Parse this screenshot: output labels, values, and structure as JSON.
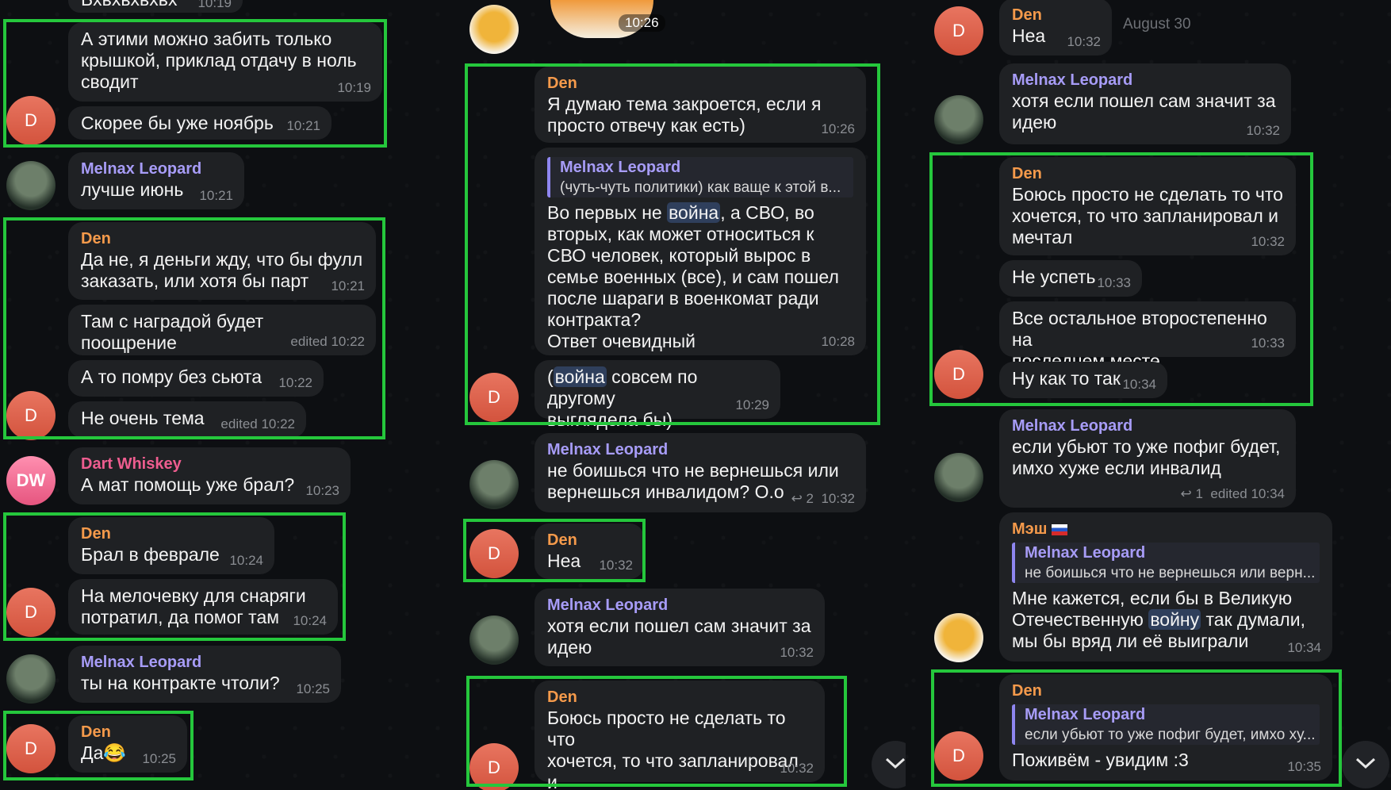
{
  "column1": {
    "top_cut_text": "Бхвхвхвхвх",
    "top_cut_time": "10:19",
    "messages": [
      {
        "text": "А этими можно забить только\nкрышкой, приклад отдачу в ноль\nсводит",
        "time": "10:19"
      },
      {
        "text": "Скорее бы уже ноябрь",
        "time": "10:21"
      },
      {
        "sender": "Melnax Leopard",
        "text": "лучше июнь",
        "time": "10:21"
      },
      {
        "sender": "Den",
        "text": "Да не, я деньги жду, что бы фулл\nзаказать, или хотя бы парт",
        "time": "10:21"
      },
      {
        "text": "Там с наградой будет поощрение",
        "time": "edited 10:22"
      },
      {
        "text": "А то помру без сьюта",
        "time": "10:22"
      },
      {
        "text": "Не очень тема",
        "time": "edited 10:22"
      },
      {
        "sender": "Dart Whiskey",
        "text": "А мат помощь уже брал?",
        "time": "10:23"
      },
      {
        "sender": "Den",
        "text": "Брал в феврале",
        "time": "10:24"
      },
      {
        "text": "На мелочевку для снаряги\nпотратил, да помог там",
        "time": "10:24"
      },
      {
        "sender": "Melnax Leopard",
        "text": "ты на контракте чтоли?",
        "time": "10:25"
      },
      {
        "sender": "Den",
        "text": "Да😂",
        "time": "10:25"
      }
    ],
    "avatars": {
      "d": "D",
      "dw": "DW"
    }
  },
  "column2": {
    "sticker_time": "10:26",
    "messages": [
      {
        "sender": "Den",
        "text": "Я думаю тема закроется, если я\nпросто отвечу как есть)",
        "time": "10:26"
      },
      {
        "quote_name": "Melnax Leopard",
        "quote_text": "(чуть-чуть политики) как ваще к этой в...",
        "text_before": "Во первых не ",
        "highlight": "война",
        "text_after": ", а СВО, во\nвторых, как может относиться к\nСВО человек, который вырос в\nсемье военных (все), и сам пошел\nпосле шараги в военкомат ради\nконтракта?\nОтвет очевидный",
        "time": "10:28"
      },
      {
        "text_before": "(",
        "highlight": "война",
        "text_after": " совсем по другому\nвыглядела бы)",
        "time": "10:29"
      },
      {
        "sender": "Melnax Leopard",
        "text": "не боишься что не вернешься или\nвернешься инвалидом? О.о",
        "replies": "2",
        "time": "10:32"
      },
      {
        "sender": "Den",
        "text": "Неа",
        "time": "10:32"
      },
      {
        "sender": "Melnax Leopard",
        "text": "хотя если пошел сам значит за\nидею",
        "time": "10:32"
      },
      {
        "sender": "Den",
        "text": "Боюсь просто не сделать то что\nхочется, то что запланировал и\nмечтал",
        "time": "10:32"
      }
    ]
  },
  "column3": {
    "date_label": "August 30",
    "messages": [
      {
        "sender": "Den",
        "text": "Неа",
        "time": "10:32"
      },
      {
        "sender": "Melnax Leopard",
        "text": "хотя если пошел сам значит за\nидею",
        "time": "10:32"
      },
      {
        "sender": "Den",
        "text": "Боюсь просто не сделать то что\nхочется, то что запланировал и\nмечтал",
        "time": "10:32"
      },
      {
        "text": "Не успеть",
        "time": "10:33"
      },
      {
        "text": "Все остальное второстепенно на\nпоследнем месте",
        "time": "10:33"
      },
      {
        "text": "Ну как то так",
        "time": "10:34"
      },
      {
        "sender": "Melnax Leopard",
        "text": "если убьют то уже пофиг будет,\nимхо хуже если инвалид",
        "replies": "1",
        "time": "edited 10:34"
      },
      {
        "sender": "Мэш",
        "quote_name": "Melnax Leopard",
        "quote_text": "не боишься что не вернешься или верн...",
        "text_before": "Мне кажется, если бы в Великую\nОтечественную ",
        "highlight": "войну",
        "text_after": " так думали,\nмы бы вряд ли её выиграли",
        "time": "10:34"
      },
      {
        "sender": "Den",
        "quote_name": "Melnax Leopard",
        "quote_text": "если убьют то уже пофиг будет, имхо ху...",
        "text": "Поживём - увидим :3",
        "time": "10:35"
      }
    ]
  },
  "colors": {
    "selection": "#25c73c",
    "bubble": "#1f2124",
    "den": "#f59a4b",
    "melnax": "#a79cf7",
    "dart": "#ee5d8f"
  }
}
